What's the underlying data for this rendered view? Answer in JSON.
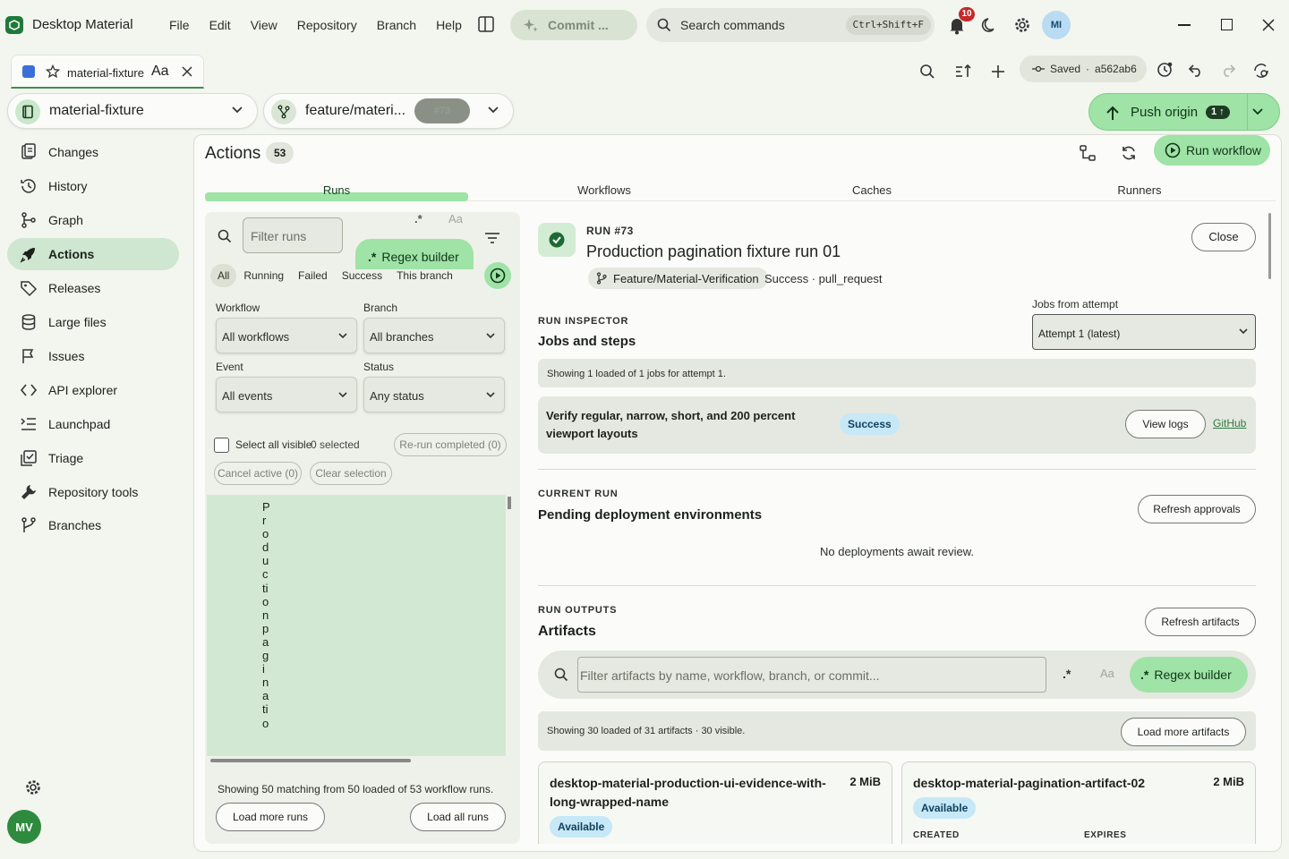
{
  "app": {
    "name": "Desktop Material",
    "menu": [
      "File",
      "Edit",
      "View",
      "Repository",
      "Branch",
      "Help"
    ],
    "commit_label": "Commit ...",
    "search_placeholder": "Search commands",
    "search_shortcut": "Ctrl+Shift+F",
    "notification_count": "10",
    "avatar_initials": "MI"
  },
  "tab": {
    "label": "material-fixture",
    "case_label": "Aa"
  },
  "toolbar": {
    "saved_label": "Saved",
    "saved_hash": "a562ab6"
  },
  "repo": {
    "name": "material-fixture",
    "branch": "feature/materi...",
    "pr_chip": "#73",
    "push_label": "Push origin",
    "push_count": "1"
  },
  "sidebar": {
    "items": [
      {
        "label": "Changes",
        "icon": "changes-icon"
      },
      {
        "label": "History",
        "icon": "history-icon"
      },
      {
        "label": "Graph",
        "icon": "graph-icon"
      },
      {
        "label": "Actions",
        "icon": "rocket-icon",
        "active": true
      },
      {
        "label": "Releases",
        "icon": "tag-icon"
      },
      {
        "label": "Large files",
        "icon": "database-icon"
      },
      {
        "label": "Issues",
        "icon": "issue-icon"
      },
      {
        "label": "API explorer",
        "icon": "code-icon"
      },
      {
        "label": "Launchpad",
        "icon": "list-icon"
      },
      {
        "label": "Triage",
        "icon": "triage-icon"
      },
      {
        "label": "Repository tools",
        "icon": "wrench-icon"
      },
      {
        "label": "Branches",
        "icon": "branch-icon"
      }
    ],
    "user_initials": "MV"
  },
  "actions": {
    "title": "Actions",
    "count": "53",
    "run_workflow": "Run workflow",
    "tabs": [
      "Runs",
      "Workflows",
      "Caches",
      "Runners"
    ]
  },
  "runs": {
    "filter_placeholder": "Filter runs",
    "regex_glyph": ".*",
    "case_glyph": "Aa",
    "regex_builder": "Regex builder",
    "chips": [
      "All",
      "Running",
      "Failed",
      "Success",
      "This branch"
    ],
    "workflow_label": "Workflow",
    "workflow_value": "All workflows",
    "branch_label": "Branch",
    "branch_value": "All branches",
    "event_label": "Event",
    "event_value": "All events",
    "status_label": "Status",
    "status_value": "Any status",
    "select_all": "Select all visible",
    "selected": "0 selected",
    "rerun": "Re-run completed (0)",
    "cancel": "Cancel active (0)",
    "clear": "Clear selection",
    "list_item_text": "Production paginatio",
    "showing": "Showing 50 matching from 50 loaded of 53 workflow runs.",
    "load_more": "Load more runs",
    "load_all": "Load all runs"
  },
  "detail": {
    "run_number": "RUN #73",
    "title": "Production pagination fixture run 01",
    "branch": "Feature/Material-Verification",
    "meta": "Success · pull_request",
    "close": "Close",
    "inspector_kicker": "RUN INSPECTOR",
    "inspector_title": "Jobs and steps",
    "attempt_label": "Jobs from attempt",
    "attempt_value": "Attempt 1 (latest)",
    "jobs_info": "Showing 1 loaded of 1 jobs for attempt 1.",
    "job_name": "Verify regular, narrow, short, and 200 percent viewport layouts",
    "job_status": "Success",
    "view_logs": "View logs",
    "github_link": "GitHub",
    "current_kicker": "CURRENT RUN",
    "pending_title": "Pending deployment environments",
    "refresh_approvals": "Refresh approvals",
    "no_deployments": "No deployments await review.",
    "outputs_kicker": "RUN OUTPUTS",
    "artifacts_title": "Artifacts",
    "refresh_artifacts": "Refresh artifacts",
    "artifact_filter_placeholder": "Filter artifacts by name, workflow, branch, or commit...",
    "regex_glyph": ".*",
    "case_glyph": "Aa",
    "regex_builder": "Regex builder",
    "artifacts_info": "Showing 30 loaded of 31 artifacts · 30 visible.",
    "load_more_artifacts": "Load more artifacts",
    "artifacts": [
      {
        "name": "desktop-material-production-ui-evidence-with-long-wrapped-name",
        "size": "2 MiB",
        "status": "Available"
      },
      {
        "name": "desktop-material-pagination-artifact-02",
        "size": "2 MiB",
        "status": "Available",
        "created_label": "CREATED",
        "expires_label": "EXPIRES"
      }
    ]
  },
  "colors": {
    "accent": "#9fe3a6",
    "active_nav": "#cfe7d0",
    "brand": "#1f7a3a",
    "badge": "#c62828"
  }
}
